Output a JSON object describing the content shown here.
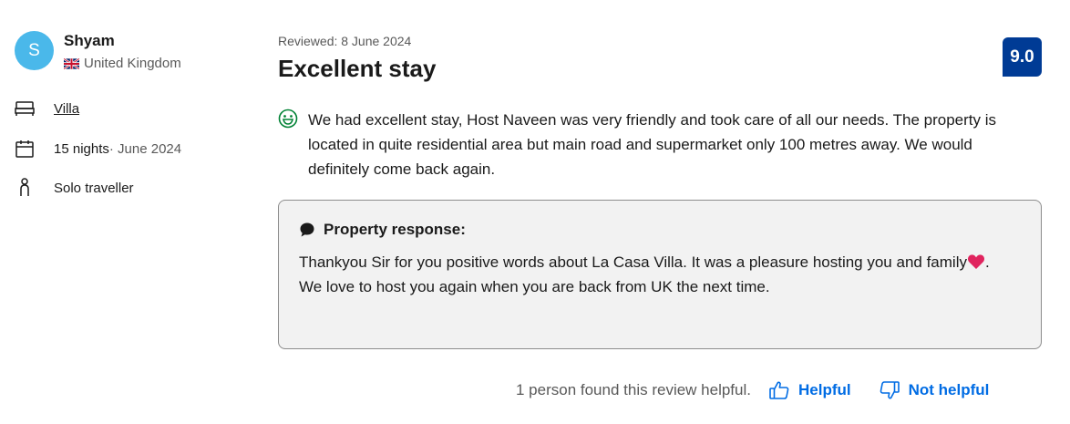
{
  "reviewer": {
    "initial": "S",
    "name": "Shyam",
    "country": "United Kingdom",
    "flag_icon": "uk-flag-icon"
  },
  "stay": {
    "room": "Villa",
    "nights": "15 nights",
    "date": " · June 2024",
    "traveller_type": "Solo traveller"
  },
  "review": {
    "date": "Reviewed: 8 June 2024",
    "title": "Excellent stay",
    "score": "9.0",
    "positive": "We had excellent stay, Host Naveen was very friendly and took care of all our needs. The property is located in quite residential area but main road and supermarket only 100 metres away. We would definitely come back again."
  },
  "property_response": {
    "heading": "Property response:",
    "line1": "Thankyou Sir for you positive words about La Casa Villa. It was a pleasure hosting you and family",
    "line1_end": ".",
    "line2": "We love to host you again when you are back from UK the next time."
  },
  "helpfulness": {
    "count_text": "1 person found this review helpful.",
    "helpful_label": "Helpful",
    "not_helpful_label": "Not helpful"
  },
  "colors": {
    "avatar": "#4ab8ea",
    "score_badge": "#003b95",
    "link": "#006ce4",
    "positive_icon": "#008234"
  }
}
